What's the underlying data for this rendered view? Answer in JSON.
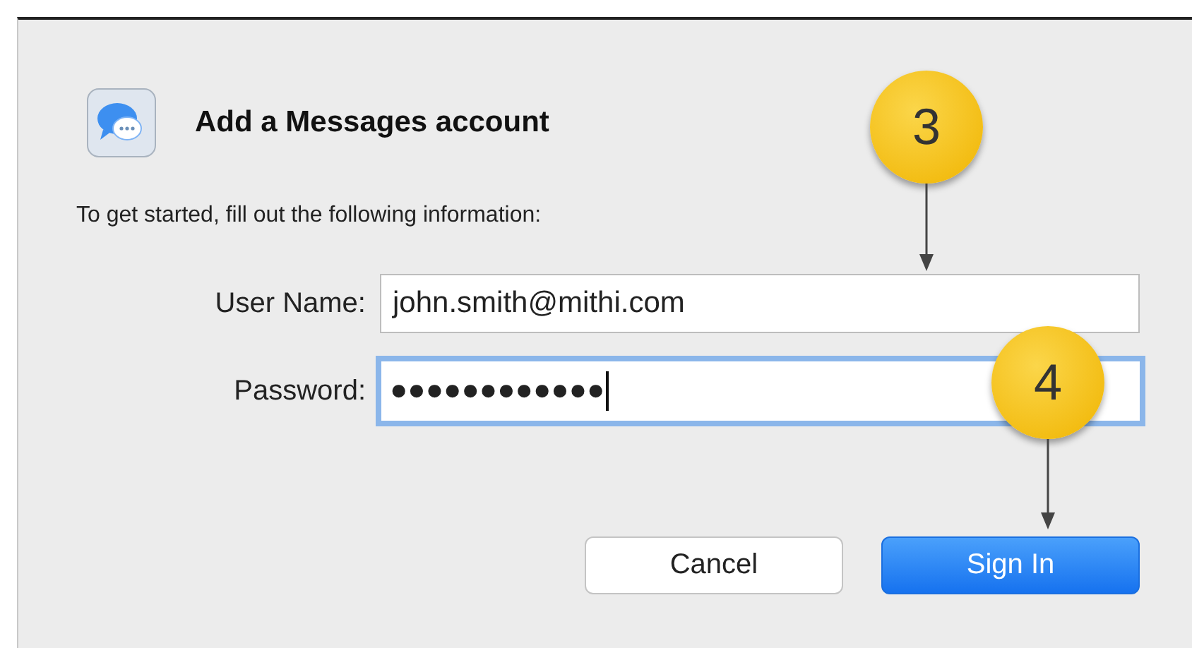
{
  "dialog": {
    "title": "Add a Messages account",
    "instructions": "To get started, fill out the following information:"
  },
  "fields": [
    {
      "label": "User Name:",
      "value": "john.smith@mithi.com",
      "focused": false
    },
    {
      "label": "Password:",
      "value": "●●●●●●●●●●●●",
      "focused": true
    }
  ],
  "buttons": [
    {
      "label": "Cancel",
      "primary": false
    },
    {
      "label": "Sign In",
      "primary": true
    }
  ],
  "callouts": [
    {
      "number": "3"
    },
    {
      "number": "4"
    }
  ]
}
